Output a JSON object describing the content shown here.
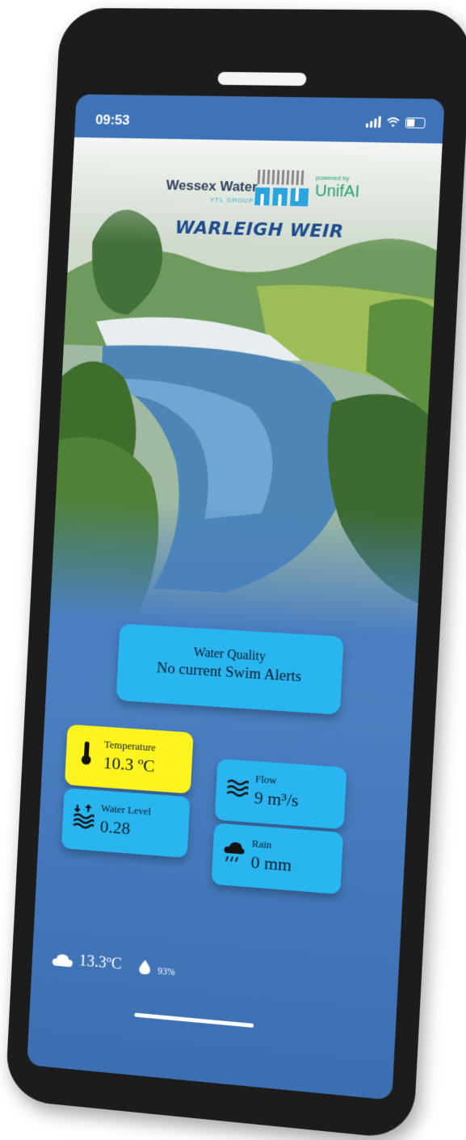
{
  "status_bar": {
    "time": "09:53"
  },
  "branding": {
    "wessex_water": "Wessex Water",
    "ytl_group": "YTL GROUP",
    "powered_by": "powered by",
    "unifai": "UnifAI"
  },
  "site_title": "WARLEIGH WEIR",
  "water_quality": {
    "label": "Water Quality",
    "status": "No current Swim Alerts"
  },
  "metrics": [
    {
      "label": "Temperature",
      "value": "10.3 ºC",
      "icon": "thermometer-icon",
      "color": "#fdf31f"
    },
    {
      "label": "Flow",
      "value": "9 m³/s",
      "icon": "waves-icon",
      "color": "#29b5ef"
    },
    {
      "label": "Water Level",
      "value": "0.28",
      "icon": "water-level-icon",
      "color": "#29b5ef"
    },
    {
      "label": "Rain",
      "value": "0 mm",
      "icon": "rain-cloud-icon",
      "color": "#29b5ef"
    }
  ],
  "weather": {
    "air_temp": "13.3ºC",
    "humidity": "93%"
  },
  "colors": {
    "screen_blue": "#3f73b8",
    "tile_blue": "#29b5ef",
    "highlight_yellow": "#fdf31f"
  }
}
